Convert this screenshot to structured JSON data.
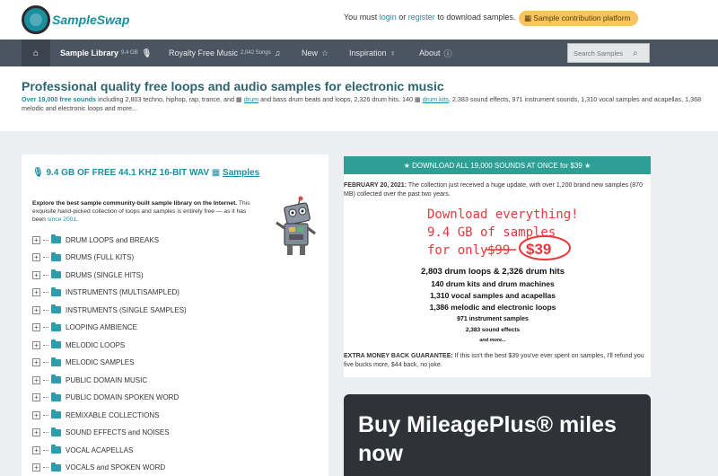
{
  "header": {
    "logo_text": "SampleSwap",
    "message_prefix": "You must",
    "login_label": "login",
    "message_or": "or",
    "register_label": "register",
    "message_suffix": "to download samples.",
    "contribution_label": "Sample contribution platform"
  },
  "nav": {
    "home_icon": "home-icon",
    "items": [
      {
        "label": "Sample Library",
        "sub": "9.4 GB",
        "icon": "microphone-icon"
      },
      {
        "label": "Royalty Free Music",
        "sub": "2,042 Songs",
        "icon": "music-note-icon"
      },
      {
        "label": "New",
        "sub": "",
        "icon": "star-icon"
      },
      {
        "label": "Inspiration",
        "sub": "",
        "icon": "lightbulb-icon"
      },
      {
        "label": "About",
        "sub": "",
        "icon": "info-icon"
      }
    ],
    "search_placeholder": "Search Samples"
  },
  "hero": {
    "title": "Professional quality free loops and audio samples for electronic music",
    "count_highlight": "Over 19,000 free sounds",
    "text_1": "including 2,803 techno, hiphop, rap, trance, and",
    "drum_link": "drum",
    "text_2": "and bass drum beats and loops, 2,326 drum hits, 140",
    "drum_kits_link": "drum kits",
    "text_3": ", 2,383 sound effects, 971 instrument sounds, 1,310 vocal samples and acapellas, 1,368 melodic and electronic loops and more..."
  },
  "library": {
    "title_prefix": "9.4 GB OF FREE 44.1 KHZ 16-BIT WAV",
    "title_link": "Samples",
    "desc_bold": "Explore the best sample community-built sample library on the Internet.",
    "desc_text": "This exquisite hand-picked collection of loops and samples is entirely free — as it has been",
    "since_link": "since 2001",
    "categories": [
      "DRUM LOOPS and BREAKS",
      "DRUMS (FULL KITS)",
      "DRUMS (SINGLE HITS)",
      "INSTRUMENTS (MULTISAMPLED)",
      "INSTRUMENTS (SINGLE SAMPLES)",
      "LOOPING AMBIENCE",
      "MELODIC LOOPS",
      "MELODIC SAMPLES",
      "PUBLIC DOMAIN MUSIC",
      "PUBLIC DOMAIN SPOKEN WORD",
      "REMIXABLE COLLECTIONS",
      "SOUND EFFECTS and NOISES",
      "VOCAL ACAPELLAS",
      "VOCALS and SPOKEN WORD"
    ]
  },
  "download": {
    "banner": "DOWNLOAD ALL 19,000 SOUNDS AT ONCE for $39",
    "date_bold": "FEBRUARY 20, 2021:",
    "date_text": "The collection just received a huge update, with over 1,200 brand new samples (870 MB) collected over the past two years.",
    "promo_line1": "Download everything!",
    "promo_line2": "9.4 GB of samples",
    "promo_line3": "for only",
    "promo_old_price": "$99",
    "promo_new_price": "$39",
    "stats": [
      "2,803 drum loops & 2,326 drum hits",
      "140 drum kits and drum machines",
      "1,310 vocal samples and acapellas",
      "1,386 melodic and electronic loops",
      "971 instrument samples",
      "2,383 sound effects",
      "and more..."
    ],
    "guarantee_bold": "EXTRA MONEY BACK GUARANTEE:",
    "guarantee_text": "If this isn't the best $39 you've ever spent on samples, I'll refund you five bucks more, $44 back, no joke."
  },
  "ad": {
    "text": "Buy MileagePlus® miles now"
  },
  "colors": {
    "brand": "#1a8fa0",
    "nav_bg": "#4a5561",
    "banner": "#2d9f95",
    "promo_red": "#e8383d",
    "pill": "#f6c462"
  }
}
